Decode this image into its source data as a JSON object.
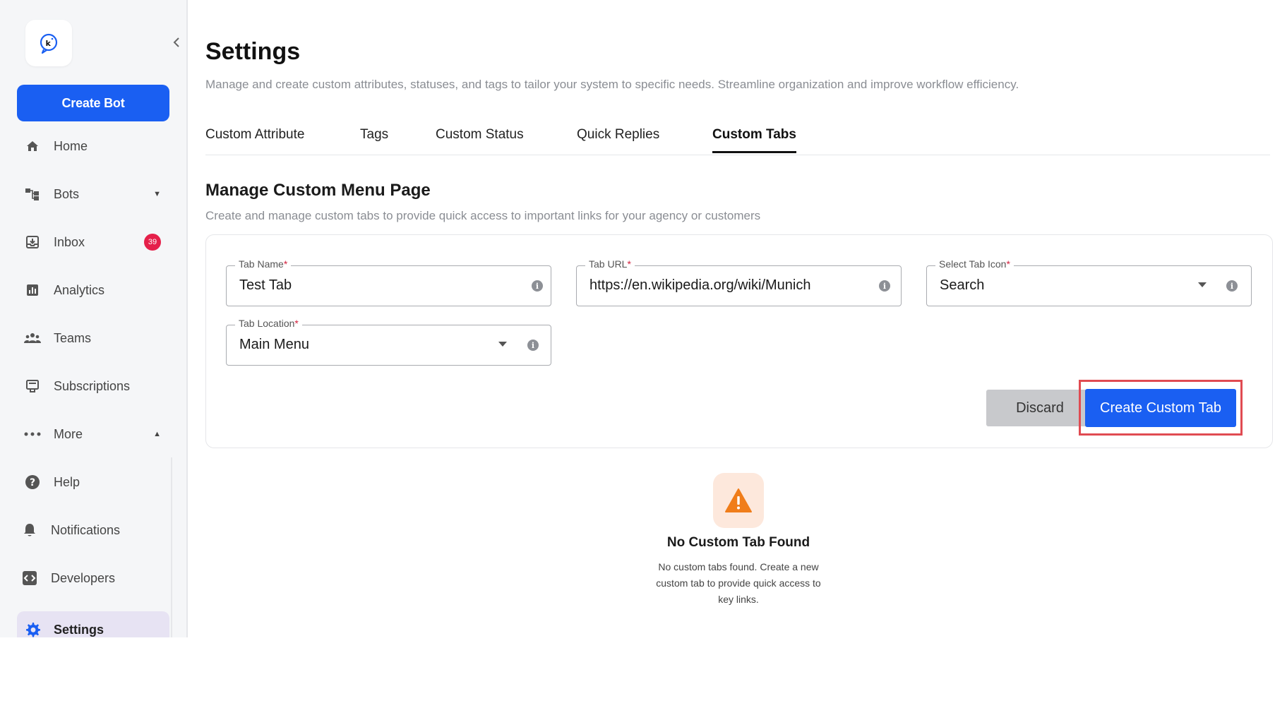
{
  "sidebar": {
    "create_bot_label": "Create Bot",
    "items": [
      {
        "label": "Home",
        "icon": "home-icon"
      },
      {
        "label": "Bots",
        "icon": "bots-icon"
      },
      {
        "label": "Inbox",
        "icon": "inbox-icon",
        "badge": "39"
      },
      {
        "label": "Analytics",
        "icon": "analytics-icon"
      },
      {
        "label": "Teams",
        "icon": "teams-icon"
      },
      {
        "label": "Subscriptions",
        "icon": "subscriptions-icon"
      },
      {
        "label": "More",
        "icon": "more-icon"
      },
      {
        "label": "Help",
        "icon": "help-icon"
      },
      {
        "label": "Notifications",
        "icon": "bell-icon"
      },
      {
        "label": "Developers",
        "icon": "developers-icon"
      },
      {
        "label": "Settings",
        "icon": "gear-icon"
      }
    ]
  },
  "header": {
    "title": "Settings",
    "subtitle": "Manage and create custom attributes, statuses, and tags to tailor your system to specific needs. Streamline organization and improve workflow efficiency."
  },
  "tabs": [
    {
      "label": "Custom Attribute"
    },
    {
      "label": "Tags"
    },
    {
      "label": "Custom Status"
    },
    {
      "label": "Quick Replies"
    },
    {
      "label": "Custom Tabs",
      "active": true
    }
  ],
  "section": {
    "title": "Manage Custom Menu Page",
    "subtitle": "Create and manage custom tabs to provide quick access to important links for your agency or customers"
  },
  "form": {
    "tab_name": {
      "label": "Tab Name",
      "required": "*",
      "value": "Test Tab"
    },
    "tab_url": {
      "label": "Tab URL",
      "required": "*",
      "value": "https://en.wikipedia.org/wiki/Munich"
    },
    "tab_icon": {
      "label": "Select Tab Icon",
      "required": "*",
      "value": "Search"
    },
    "tab_location": {
      "label": "Tab Location",
      "required": "*",
      "value": "Main Menu"
    },
    "discard_label": "Discard",
    "create_label": "Create Custom Tab"
  },
  "empty_state": {
    "title": "No Custom Tab Found",
    "description": "No custom tabs found. Create a new custom tab to provide quick access to key links."
  },
  "colors": {
    "accent": "#1a5ff2",
    "badge": "#e5204a",
    "highlight": "#e04b52",
    "warning": "#f07d1a"
  }
}
